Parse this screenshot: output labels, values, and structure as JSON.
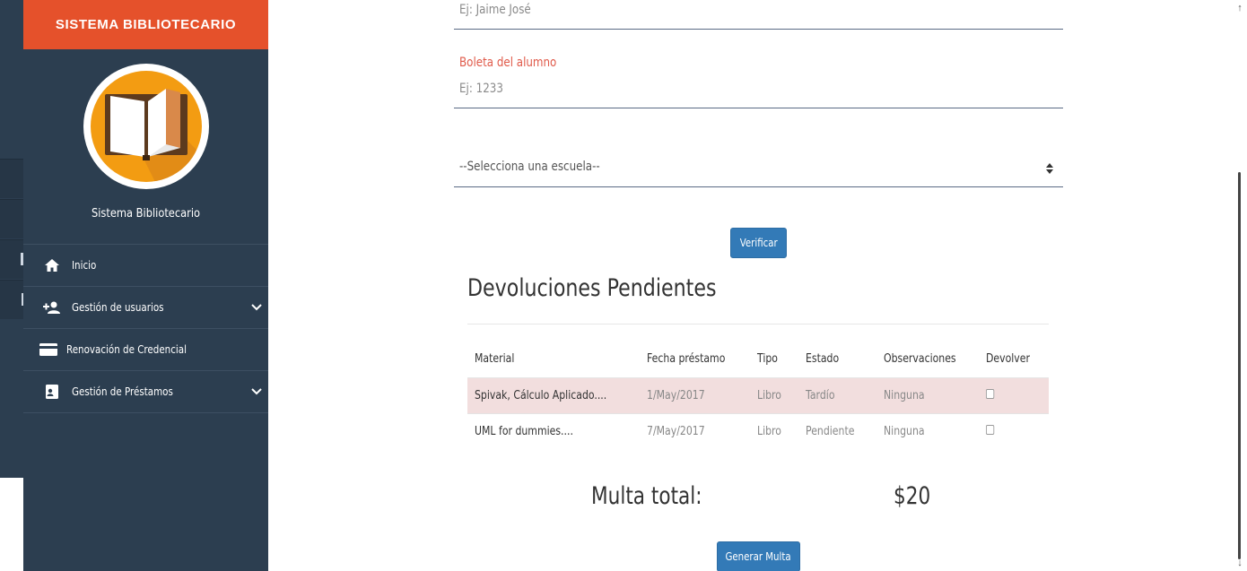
{
  "sidebar": {
    "brand": "SISTEMA BIBLIOTECARIO",
    "system_name": "Sistema Bibliotecario",
    "items": [
      {
        "label": "Inicio",
        "icon": "home-icon"
      },
      {
        "label": "Gestión de usuarios",
        "icon": "add-user-icon",
        "expandable": true
      },
      {
        "label": "Renovación de Credencial",
        "icon": "credit-card-icon"
      },
      {
        "label": "Gestión de Préstamos",
        "icon": "contact-card-icon",
        "expandable": true
      }
    ]
  },
  "form": {
    "name_placeholder": "Ej: Jaime José",
    "boleta_label": "Boleta del alumno",
    "boleta_placeholder": "Ej: 1233",
    "school_select_value": "--Selecciona una escuela--",
    "verify_button": "Verificar"
  },
  "devoluciones": {
    "title": "Devoluciones Pendientes",
    "columns": [
      "Material",
      "Fecha préstamo",
      "Tipo",
      "Estado",
      "Observaciones",
      "Devolver"
    ],
    "rows": [
      {
        "material": "Spivak, Cálculo Aplicado....",
        "fecha": "1/May/2017",
        "tipo": "Libro",
        "estado": "Tardío",
        "observaciones": "Ninguna",
        "devolver": false
      },
      {
        "material": "UML for dummies....",
        "fecha": "7/May/2017",
        "tipo": "Libro",
        "estado": "Pendiente",
        "observaciones": "Ninguna",
        "devolver": false
      }
    ]
  },
  "multa": {
    "label": "Multa total:",
    "value": "$20",
    "generate_button": "Generar Multa"
  },
  "colors": {
    "brand": "#e5512b",
    "sidebar": "#2c3e50",
    "primary_button": "#337ab7",
    "late_row": "#f2dede",
    "field_label": "#e05a4a",
    "logo_orange": "#f39c12"
  }
}
